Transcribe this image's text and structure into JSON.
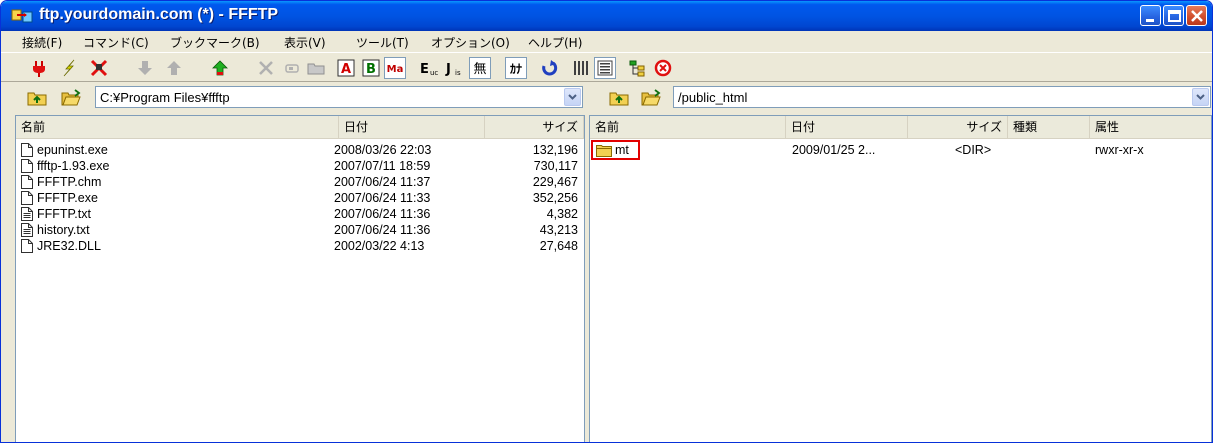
{
  "window": {
    "title": "ftp.yourdomain.com (*) - FFFTP"
  },
  "menu": [
    "接続(F)",
    "コマンド(C)",
    "ブックマーク(B)",
    "表示(V)",
    "ツール(T)",
    "オプション(O)",
    "ヘルプ(H)"
  ],
  "toolbar": {
    "ascii_label": "A",
    "binary_label": "B",
    "auto_label": "Ma",
    "euc_label": "E",
    "euc_sub": "uc",
    "jis_label": "J",
    "jis_sub": "is",
    "none_label": "無",
    "kana_label": "ｶﾅ"
  },
  "local": {
    "path": "C:¥Program Files¥ffftp",
    "columns": {
      "name": "名前",
      "date": "日付",
      "size": "サイズ"
    },
    "files": [
      {
        "name": "epuninst.exe",
        "date": "2008/03/26 22:03",
        "size": "132,196",
        "icon": "file-icon"
      },
      {
        "name": "ffftp-1.93.exe",
        "date": "2007/07/11 18:59",
        "size": "730,117",
        "icon": "file-icon"
      },
      {
        "name": "FFFTP.chm",
        "date": "2007/06/24 11:37",
        "size": "229,467",
        "icon": "file-icon"
      },
      {
        "name": "FFFTP.exe",
        "date": "2007/06/24 11:33",
        "size": "352,256",
        "icon": "file-icon"
      },
      {
        "name": "FFFTP.txt",
        "date": "2007/06/24 11:36",
        "size": "4,382",
        "icon": "text-file-icon"
      },
      {
        "name": "history.txt",
        "date": "2007/06/24 11:36",
        "size": "43,213",
        "icon": "text-file-icon"
      },
      {
        "name": "JRE32.DLL",
        "date": "2002/03/22  4:13",
        "size": "27,648",
        "icon": "file-icon"
      }
    ]
  },
  "remote": {
    "path": "/public_html",
    "columns": {
      "name": "名前",
      "date": "日付",
      "size": "サイズ",
      "type": "種類",
      "attr": "属性"
    },
    "files": [
      {
        "name": "mt",
        "date": "2009/01/25 2...",
        "size": "<DIR>",
        "type": "",
        "attr": "rwxr-xr-x",
        "icon": "folder-icon"
      }
    ]
  },
  "colors": {
    "titlebar": "#0054e3",
    "highlight": "#e20000",
    "chrome": "#ece9d8"
  }
}
